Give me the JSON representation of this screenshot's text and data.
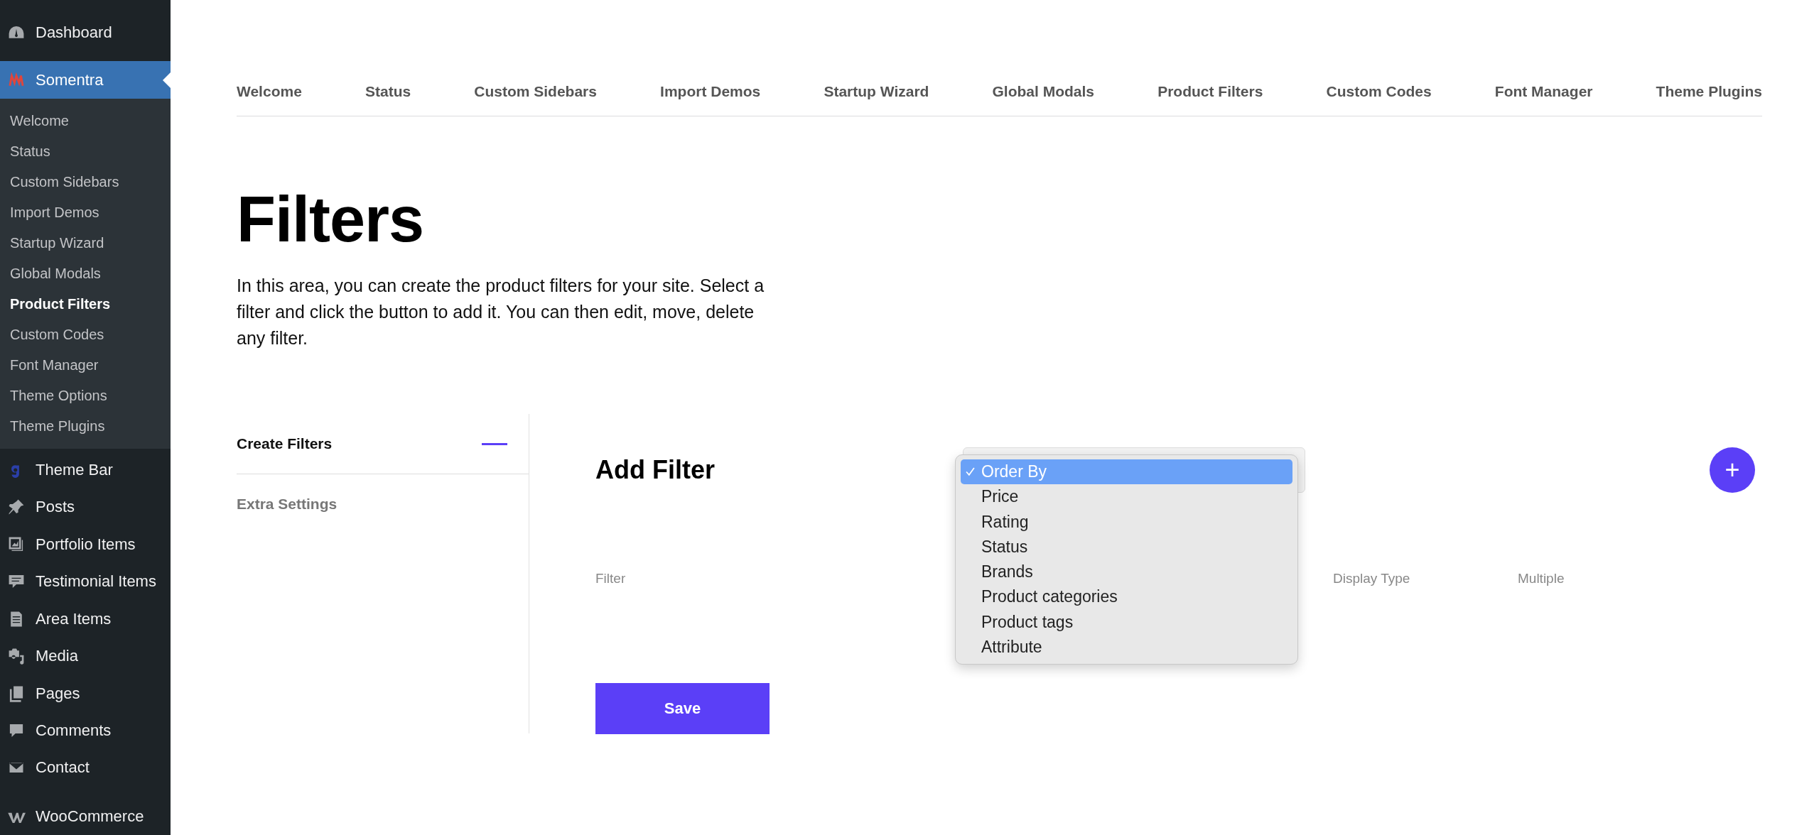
{
  "sidebar": {
    "items": [
      {
        "label": "Dashboard",
        "selected": false
      },
      {
        "label": "Somentra",
        "selected": true,
        "expanded": true,
        "children": [
          {
            "label": "Welcome",
            "selected": false
          },
          {
            "label": "Status",
            "selected": false
          },
          {
            "label": "Custom Sidebars",
            "selected": false
          },
          {
            "label": "Import Demos",
            "selected": false
          },
          {
            "label": "Startup Wizard",
            "selected": false
          },
          {
            "label": "Global Modals",
            "selected": false
          },
          {
            "label": "Product Filters",
            "selected": true
          },
          {
            "label": "Custom Codes",
            "selected": false
          },
          {
            "label": "Font Manager",
            "selected": false
          },
          {
            "label": "Theme Options",
            "selected": false
          },
          {
            "label": "Theme Plugins",
            "selected": false
          }
        ]
      },
      {
        "label": "Theme Bar",
        "selected": false
      },
      {
        "label": "Posts",
        "selected": false
      },
      {
        "label": "Portfolio Items",
        "selected": false
      },
      {
        "label": "Testimonial Items",
        "selected": false
      },
      {
        "label": "Area Items",
        "selected": false
      },
      {
        "label": "Media",
        "selected": false
      },
      {
        "label": "Pages",
        "selected": false
      },
      {
        "label": "Comments",
        "selected": false
      },
      {
        "label": "Contact",
        "selected": false
      },
      {
        "label": "WooCommerce",
        "selected": false
      }
    ]
  },
  "nav_tabs": [
    "Welcome",
    "Status",
    "Custom Sidebars",
    "Import Demos",
    "Startup Wizard",
    "Global Modals",
    "Product Filters",
    "Custom Codes",
    "Font Manager",
    "Theme Plugins"
  ],
  "page": {
    "title": "Filters",
    "description": "In this area, you can create the product filters for your site. Select a filter and click the button to add it. You can then edit, move, delete any filter."
  },
  "section_tabs": [
    {
      "label": "Create Filters",
      "selected": true
    },
    {
      "label": "Extra Settings",
      "selected": false
    }
  ],
  "panel": {
    "title": "Add Filter",
    "filter_select": {
      "expanded": true,
      "options": [
        {
          "label": "Order By",
          "selected": true
        },
        {
          "label": "Price",
          "selected": false
        },
        {
          "label": "Rating",
          "selected": false
        },
        {
          "label": "Status",
          "selected": false
        },
        {
          "label": "Brands",
          "selected": false
        },
        {
          "label": "Product categories",
          "selected": false
        },
        {
          "label": "Product tags",
          "selected": false
        },
        {
          "label": "Attribute",
          "selected": false
        }
      ]
    },
    "add_button": "+",
    "columns": [
      "Filter",
      "Display Type",
      "Multiple"
    ],
    "save_button": "Save"
  }
}
